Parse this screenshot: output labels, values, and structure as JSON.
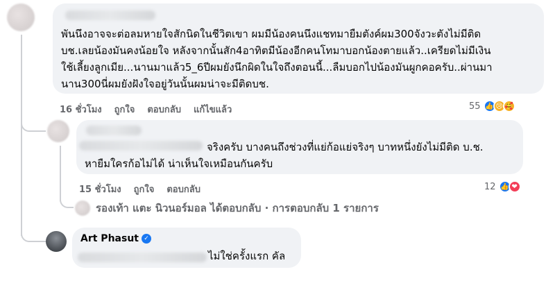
{
  "comment1": {
    "text": "พันนึงอาจจะต่อลมหายใจสักนิดในชีวิตเขา ผมมีน้องคนนึงแชทมายืมตังค์ผม300จังวะตังไม่มีติด\nบช.เลยน้องมันคงน้อยใจ หลังจากนั้นสัก4อาทิตมีน้องอีกคนโทมาบอกน้องตายแล้ว..เครียดไม่มีเงิน\nใช้เลี้ยงลูกเมีย...นานมาแล้ว5_6ปีผมยังนึกผิดในใจถึงตอนนี้...ลืมบอกไปน้องมันผูกคอครับ..ผ่านมา\nนาน300นี่ผมยังฝังใจอยู่วันนั้นผมน่าจะมีติดบช.",
    "time": "16 ชั่วโมง",
    "like": "ถูกใจ",
    "reply": "ตอบกลับ",
    "edited": "แก้ไขแล้ว",
    "reaction_count": "55"
  },
  "comment2": {
    "text": "จริงครับ บางคนถึงช่วงที่แย่ก้อแย่จริงๆ บาทหนึ่งยังไม่มีติด บ.ช.\nหายืมใครก้อไม่ได้ น่าเห็นใจเหมือนกันครับ",
    "time": "15 ชั่วโมง",
    "like": "ถูกใจ",
    "reply": "ตอบกลับ",
    "reaction_count": "12"
  },
  "replies_summary": "รองเท้า แตะ นิวนอร์มอล ได้ตอบกลับ · การตอบกลับ 1 รายการ",
  "comment3": {
    "author": "Art Phasut",
    "text": "ไม่ใช่ครั้งแรก คัล"
  },
  "colors": {
    "bubble": "#f0f2f5",
    "meta": "#65676b",
    "like_blue": "#1877f2",
    "love_red": "#f33e58"
  }
}
